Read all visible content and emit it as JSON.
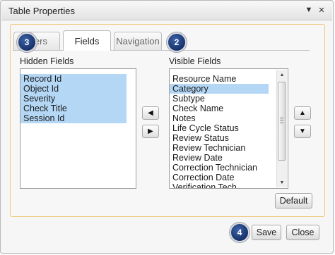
{
  "dialog": {
    "title": "Table Properties",
    "menu_icon": "dropdown-arrow-icon",
    "close_icon": "close-icon"
  },
  "tabs": [
    {
      "label": "Filters",
      "visible_text": "ers",
      "active": false
    },
    {
      "label": "Fields",
      "active": true
    },
    {
      "label": "Navigation",
      "active": false
    }
  ],
  "hidden_fields": {
    "label": "Hidden Fields",
    "items": [
      "Record Id",
      "Object Id",
      "Severity",
      "Check Title",
      "Session Id"
    ],
    "selected": [
      0,
      1,
      2,
      3,
      4
    ]
  },
  "visible_fields": {
    "label": "Visible Fields",
    "items": [
      "Resource Name",
      "Category",
      "Subtype",
      "Check Name",
      "Notes",
      "Life Cycle Status",
      "Review Status",
      "Review Technician",
      "Review Date",
      "Correction Technician",
      "Correction Date",
      "Verification Tech"
    ],
    "selected": [
      1
    ]
  },
  "move_buttons": {
    "move_left": "◀",
    "move_right": "▶"
  },
  "order_buttons": {
    "move_up": "▲",
    "move_down": "▼"
  },
  "buttons": {
    "default": "Default",
    "save": "Save",
    "close": "Close"
  },
  "callouts": [
    "3",
    "2",
    "4"
  ],
  "colors": {
    "selection": "#b3d7f5",
    "panel_border": "#f0c87a",
    "badge": "#1c3a78"
  }
}
